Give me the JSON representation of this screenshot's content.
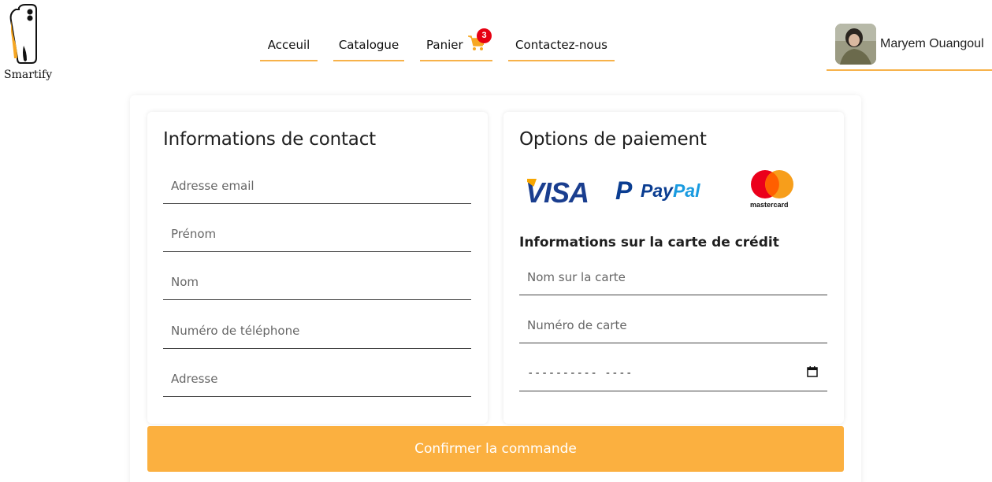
{
  "brand": {
    "name": "Smartify"
  },
  "nav": {
    "items": [
      {
        "label": "Acceuil"
      },
      {
        "label": "Catalogue"
      },
      {
        "label": "Panier",
        "badge": "3"
      },
      {
        "label": "Contactez-nous"
      }
    ],
    "accent_color": "#f7b24a"
  },
  "user": {
    "name": "Maryem Ouangoul"
  },
  "contact": {
    "title": "Informations de contact",
    "fields": {
      "email": "Adresse email",
      "firstname": "Prénom",
      "lastname": "Nom",
      "phone": "Numéro de téléphone",
      "address": "Adresse"
    }
  },
  "payment": {
    "title": "Options de paiement",
    "logos": {
      "visa": "VISA",
      "paypal_p": "P",
      "paypal_pay": "Pay",
      "paypal_pal": "Pal",
      "mastercard": "mastercard"
    },
    "card_section_title": "Informations sur la carte de crédit",
    "fields": {
      "card_name": "Nom sur la carte",
      "card_number": "Numéro de carte",
      "date_value": "---------- ----"
    }
  },
  "confirm": {
    "label": "Confirmer la commande",
    "color": "#fbb040"
  },
  "icons": [
    "cart-icon",
    "calendar-icon",
    "phone-logo-icon"
  ]
}
